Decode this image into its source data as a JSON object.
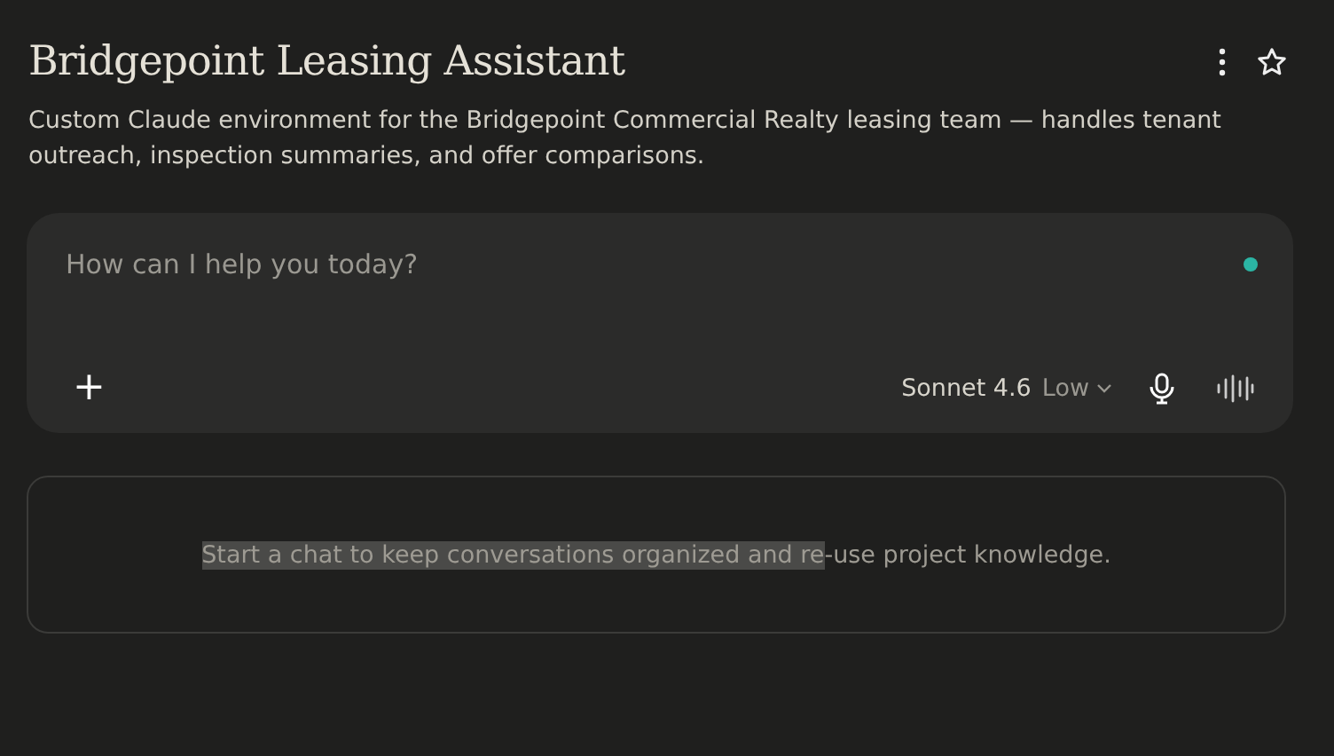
{
  "header": {
    "title": "Bridgepoint Leasing Assistant",
    "description": "Custom Claude environment for the Bridgepoint Commercial Realty leasing team — handles tenant outreach, inspection summaries, and offer comparisons."
  },
  "composer": {
    "placeholder": "How can I help you today?",
    "model": "Sonnet 4.6",
    "effort": "Low",
    "add_label": "+"
  },
  "empty_state": {
    "highlighted": "Start a chat to keep conversations organized and re",
    "rest": "-use project knowledge."
  }
}
